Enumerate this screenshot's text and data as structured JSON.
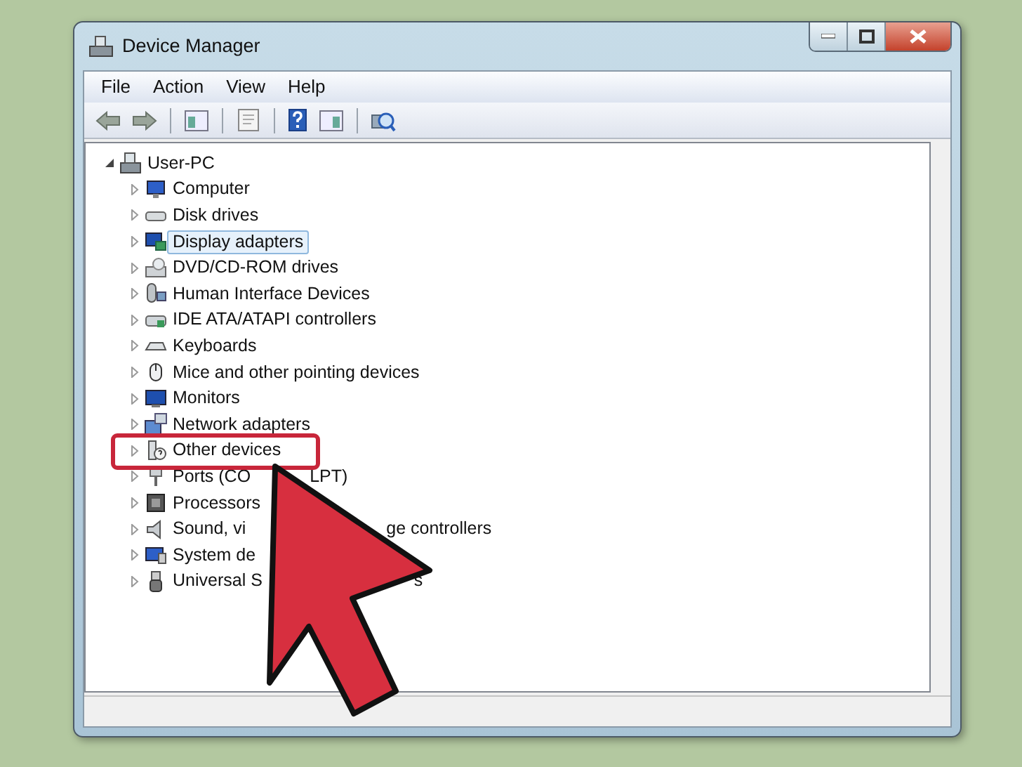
{
  "window": {
    "title": "Device Manager"
  },
  "menu": [
    "File",
    "Action",
    "View",
    "Help"
  ],
  "tree": {
    "label": "User-PC",
    "expanded": true,
    "selected": false,
    "children": [
      {
        "label": "Computer",
        "expanded": false,
        "selected": false
      },
      {
        "label": "Disk drives",
        "expanded": false,
        "selected": false
      },
      {
        "label": "Display adapters",
        "expanded": false,
        "selected": true
      },
      {
        "label": "DVD/CD-ROM drives",
        "expanded": false,
        "selected": false
      },
      {
        "label": "Human Interface Devices",
        "expanded": false,
        "selected": false
      },
      {
        "label": "IDE ATA/ATAPI controllers",
        "expanded": false,
        "selected": false
      },
      {
        "label": "Keyboards",
        "expanded": false,
        "selected": false
      },
      {
        "label": "Mice and other pointing devices",
        "expanded": false,
        "selected": false
      },
      {
        "label": "Monitors",
        "expanded": false,
        "selected": false
      },
      {
        "label": "Network adapters",
        "expanded": false,
        "selected": false
      },
      {
        "label": "Other devices",
        "expanded": false,
        "selected": false
      },
      {
        "label": "Ports (CO",
        "label_tail": "LPT)",
        "expanded": false,
        "selected": false
      },
      {
        "label": "Processors",
        "expanded": false,
        "selected": false
      },
      {
        "label": "Sound, vi",
        "label_tail": "ge controllers",
        "expanded": false,
        "selected": false
      },
      {
        "label": "System de",
        "expanded": false,
        "selected": false
      },
      {
        "label": "Universal S",
        "label_tail": "s",
        "expanded": false,
        "selected": false
      }
    ]
  }
}
